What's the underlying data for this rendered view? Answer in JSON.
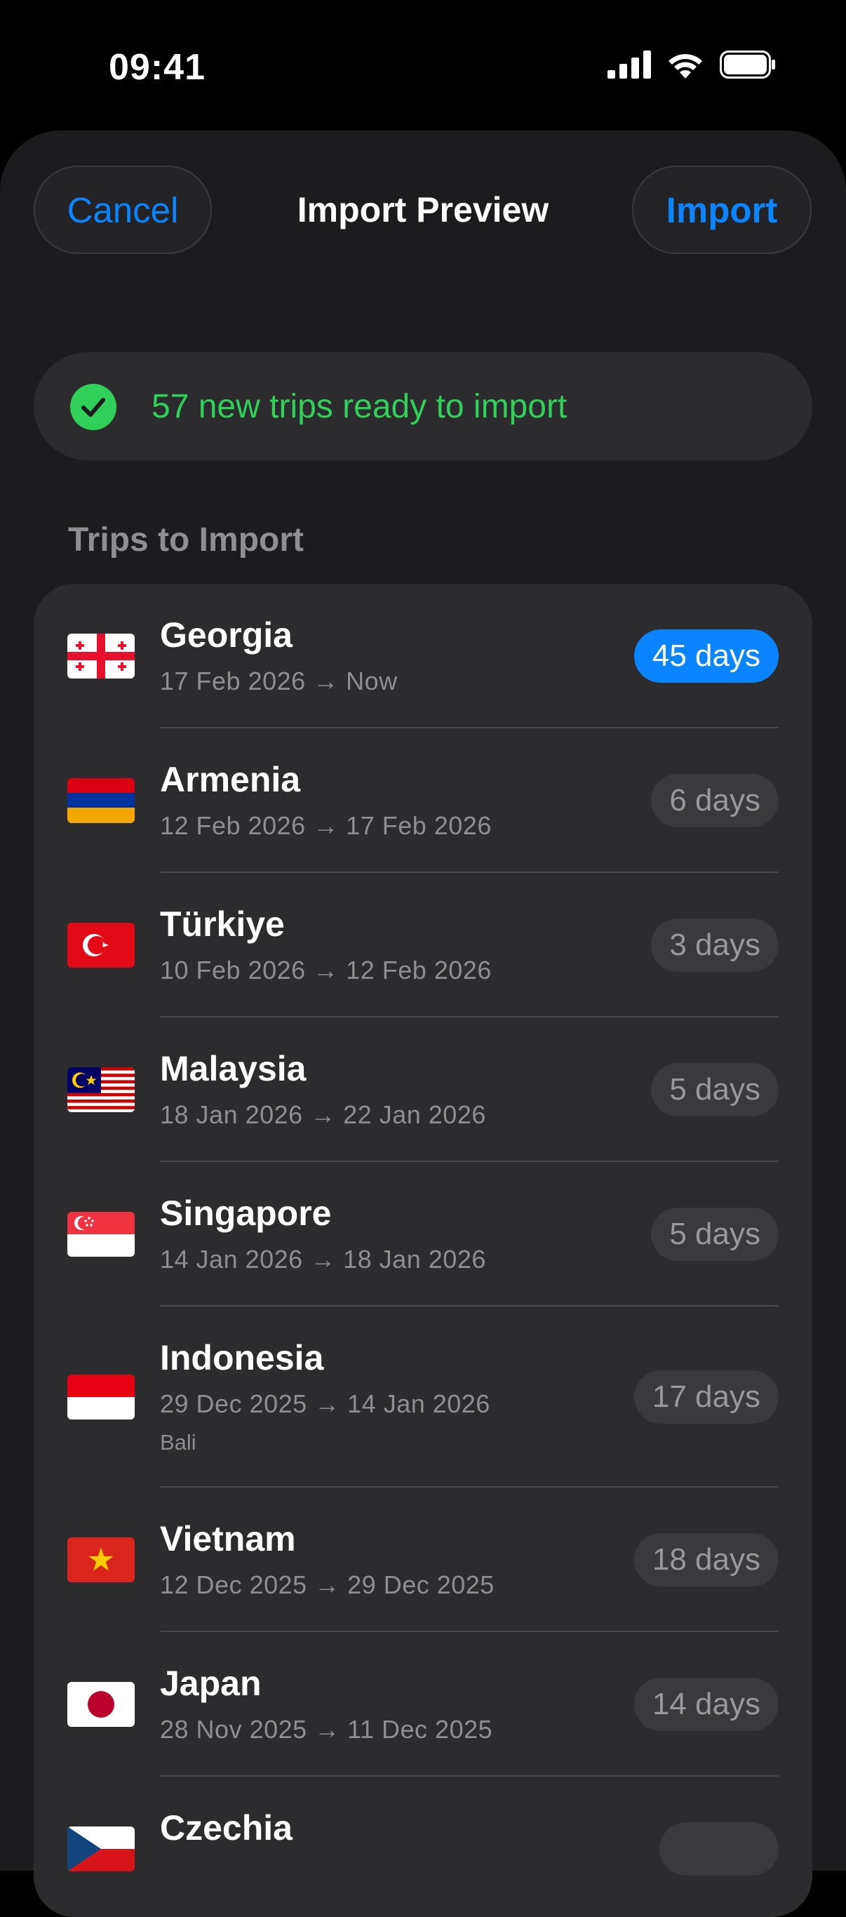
{
  "status_bar": {
    "time": "09:41",
    "icons": [
      "signal-icon",
      "wifi-icon",
      "battery-icon"
    ]
  },
  "nav": {
    "cancel_label": "Cancel",
    "title": "Import Preview",
    "import_label": "Import"
  },
  "banner": {
    "icon": "checkmark-circle-icon",
    "text": "57 new trips ready to import",
    "color": "#30d158"
  },
  "section": {
    "header": "Trips to Import"
  },
  "colors": {
    "accent": "#0a84ff",
    "background": "#1c1c1e",
    "card": "#2c2c2e"
  },
  "trips": [
    {
      "flag": "georgia-flag-icon",
      "country": "Georgia",
      "dates": "17 Feb 2026 → Now",
      "note": "",
      "duration": "45 days",
      "highlighted": true
    },
    {
      "flag": "armenia-flag-icon",
      "country": "Armenia",
      "dates": "12 Feb 2026 → 17 Feb 2026",
      "note": "",
      "duration": "6 days",
      "highlighted": false
    },
    {
      "flag": "turkiye-flag-icon",
      "country": "Türkiye",
      "dates": "10 Feb 2026 → 12 Feb 2026",
      "note": "",
      "duration": "3 days",
      "highlighted": false
    },
    {
      "flag": "malaysia-flag-icon",
      "country": "Malaysia",
      "dates": "18 Jan 2026 → 22 Jan 2026",
      "note": "",
      "duration": "5 days",
      "highlighted": false
    },
    {
      "flag": "singapore-flag-icon",
      "country": "Singapore",
      "dates": "14 Jan 2026 → 18 Jan 2026",
      "note": "",
      "duration": "5 days",
      "highlighted": false
    },
    {
      "flag": "indonesia-flag-icon",
      "country": "Indonesia",
      "dates": "29 Dec 2025 → 14 Jan 2026",
      "note": "Bali",
      "duration": "17 days",
      "highlighted": false
    },
    {
      "flag": "vietnam-flag-icon",
      "country": "Vietnam",
      "dates": "12 Dec 2025 → 29 Dec 2025",
      "note": "",
      "duration": "18 days",
      "highlighted": false
    },
    {
      "flag": "japan-flag-icon",
      "country": "Japan",
      "dates": "28 Nov 2025 → 11 Dec 2025",
      "note": "",
      "duration": "14 days",
      "highlighted": false
    },
    {
      "flag": "czechia-flag-icon",
      "country": "Czechia",
      "dates": "",
      "note": "",
      "duration": "",
      "highlighted": false
    }
  ]
}
